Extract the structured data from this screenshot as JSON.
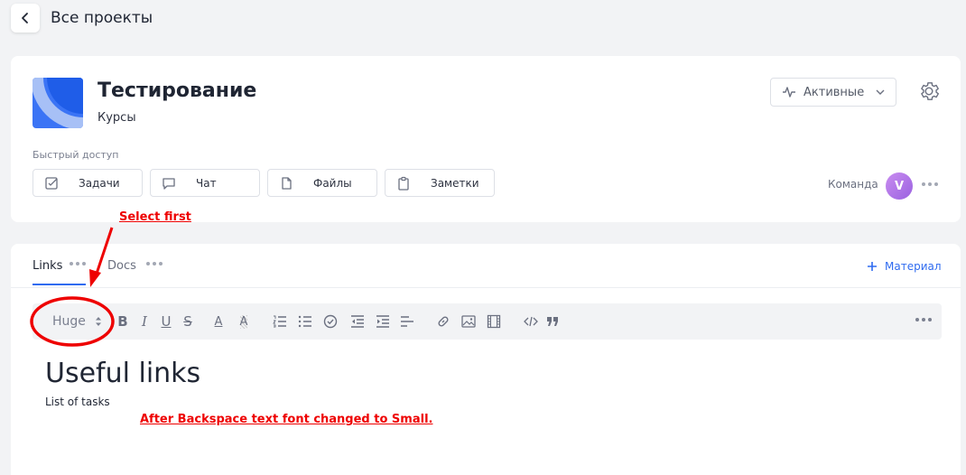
{
  "header": {
    "title": "Все проекты"
  },
  "project": {
    "title": "Тестирование",
    "subtitle": "Курсы",
    "status": "Активные",
    "quick_access_label": "Быстрый доступ",
    "quick_access": [
      {
        "label": "Задачи",
        "icon": "checkbox-icon"
      },
      {
        "label": "Чат",
        "icon": "chat-icon"
      },
      {
        "label": "Файлы",
        "icon": "file-icon"
      },
      {
        "label": "Заметки",
        "icon": "clipboard-icon"
      }
    ],
    "team_label": "Команда",
    "avatar_initial": "V"
  },
  "tabs": [
    {
      "label": "Links",
      "active": true
    },
    {
      "label": "Docs",
      "active": false
    }
  ],
  "add_material_label": "Материал",
  "toolbar": {
    "size_value": "Huge",
    "bold": "B",
    "italic": "I",
    "underline": "U",
    "strike": "S",
    "font_color": "A",
    "highlight": "A",
    "icons": [
      "ordered-list-icon",
      "bullet-list-icon",
      "checklist-icon",
      "outdent-icon",
      "indent-icon",
      "align-icon",
      "link-icon",
      "image-icon",
      "video-icon",
      "code-icon",
      "quote-icon",
      "more-icon"
    ]
  },
  "content": {
    "heading": "Useful links",
    "paragraph": "List of tasks"
  },
  "annotations": {
    "select_first": "Select first",
    "note": "After Backspace  text font changed to Small."
  },
  "colors": {
    "accent": "#2f6bf0",
    "annotation": "#e00000"
  }
}
